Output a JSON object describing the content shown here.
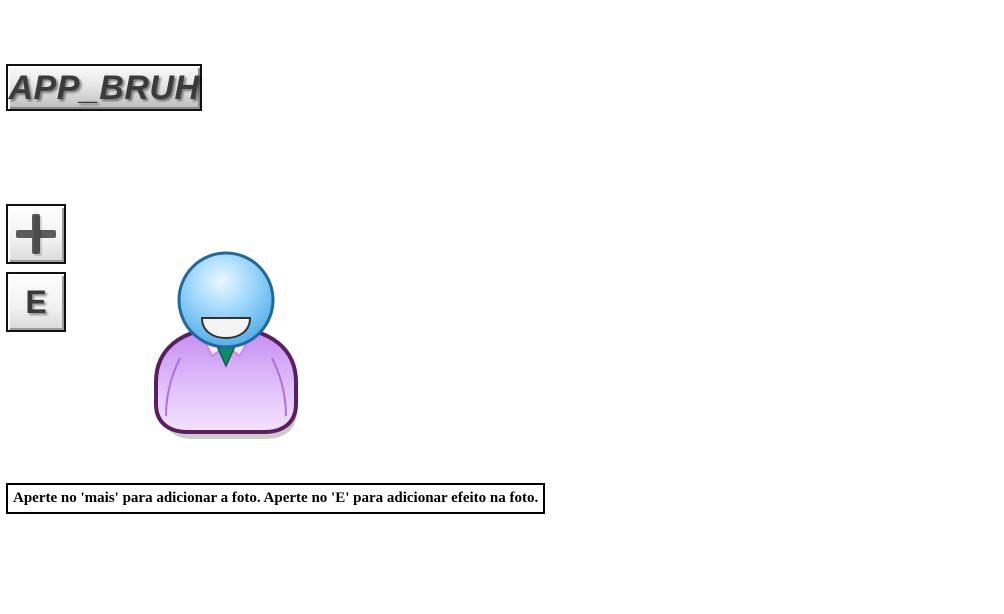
{
  "header": {
    "app_title": "APP_BRUH"
  },
  "toolbar": {
    "add_photo_icon": "plus-icon",
    "effect_label": "E"
  },
  "main": {
    "avatar_icon": "user-avatar-icon",
    "instructions": "Aperte no 'mais' para adicionar a foto. Aperte no 'E' para adicionar efeito na foto."
  },
  "colors": {
    "head_fill": "#8fd0fb",
    "head_stroke": "#1f6a9a",
    "body_fill": "#d8aaf5",
    "body_stroke": "#5a1f5e",
    "tie": "#0f8a6a"
  }
}
